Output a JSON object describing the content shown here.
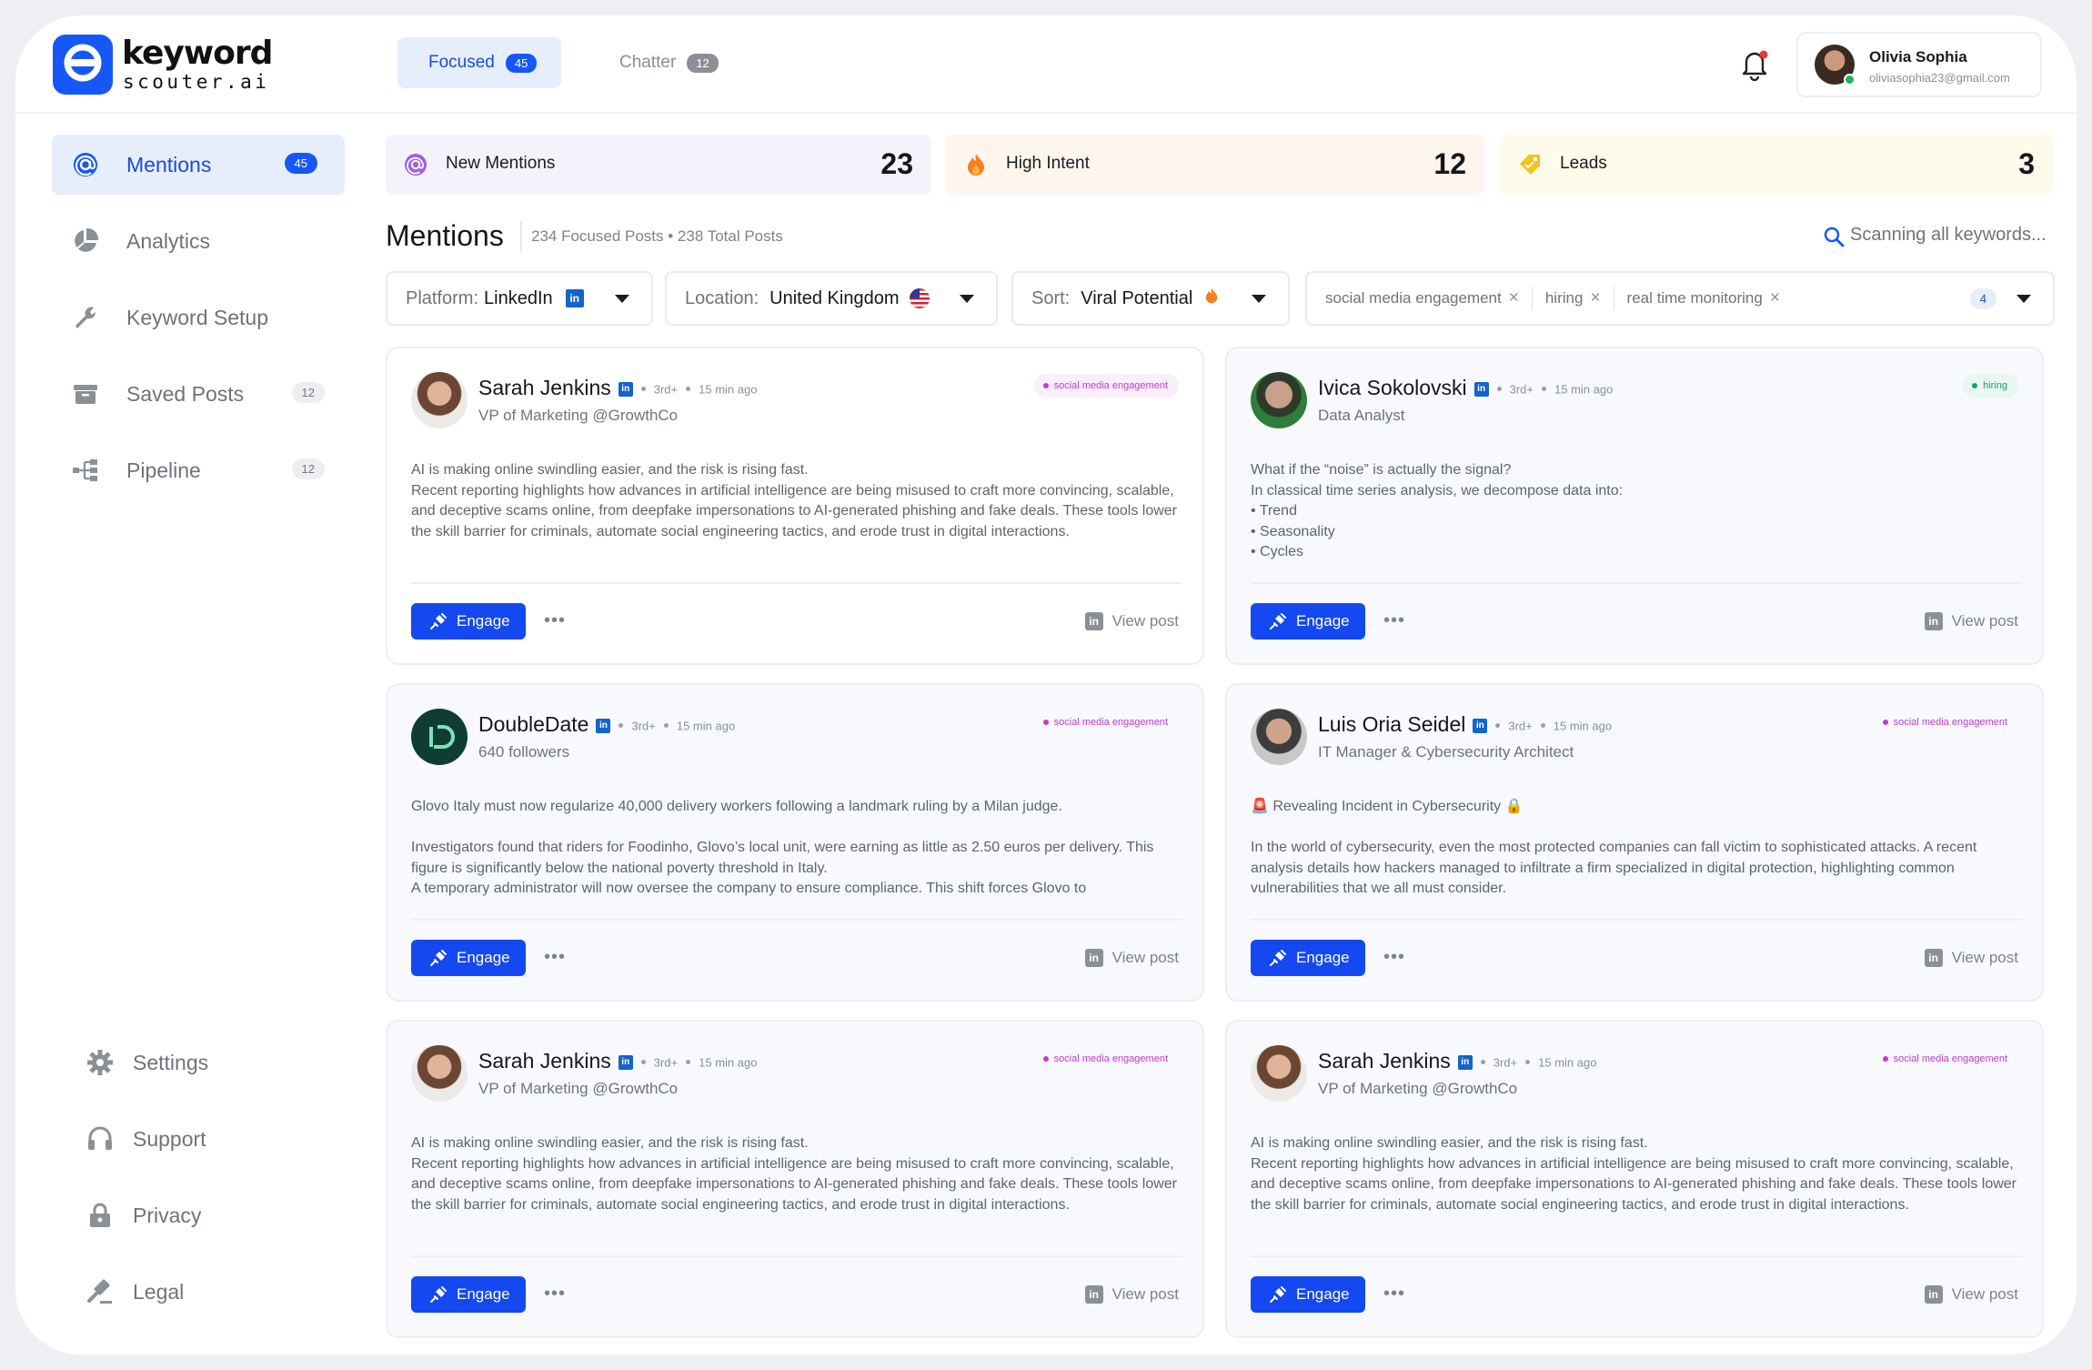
{
  "app": {
    "logo_line1": "keyword",
    "logo_line2": "scouter.ai"
  },
  "tabs": [
    {
      "label": "Focused",
      "count": "45"
    },
    {
      "label": "Chatter",
      "count": "12"
    }
  ],
  "user": {
    "name": "Olivia Sophia",
    "email": "oliviasophia23@gmail.com"
  },
  "sidebar": {
    "items": [
      {
        "label": "Mentions",
        "badge": "45",
        "icon": "at-icon"
      },
      {
        "label": "Analytics",
        "badge": "",
        "icon": "pie-chart-icon"
      },
      {
        "label": "Keyword Setup",
        "badge": "",
        "icon": "wrench-icon"
      },
      {
        "label": "Saved Posts",
        "badge": "12",
        "icon": "archive-icon"
      },
      {
        "label": "Pipeline",
        "badge": "12",
        "icon": "pipeline-icon"
      }
    ],
    "bottom": [
      {
        "label": "Settings",
        "icon": "gear-icon"
      },
      {
        "label": "Support",
        "icon": "headphones-icon"
      },
      {
        "label": "Privacy",
        "icon": "lock-icon"
      },
      {
        "label": "Legal",
        "icon": "gavel-icon"
      }
    ]
  },
  "stats": [
    {
      "label": "New Mentions",
      "value": "23",
      "color": "#f4f3fc"
    },
    {
      "label": "High Intent",
      "value": "12",
      "color": "#fef5ec"
    },
    {
      "label": "Leads",
      "value": "3",
      "color": "#fefbea"
    }
  ],
  "section": {
    "title": "Mentions",
    "subtitle": "234 Focused Posts • 238 Total Posts",
    "scanning": "Scanning all keywords..."
  },
  "filters": {
    "platform_label": "Platform:",
    "platform_value": "LinkedIn",
    "location_label": "Location:",
    "location_value": "United Kingdom",
    "sort_label": "Sort:",
    "sort_value": "Viral Potential",
    "keywords": [
      "social media engagement",
      "hiring",
      "real time monitoring"
    ],
    "keyword_count": "4"
  },
  "common": {
    "degree": "3rd+",
    "time": "15 min ago",
    "engage": "Engage",
    "more": "•••",
    "view_post": "View post"
  },
  "posts": [
    {
      "name": "Sarah Jenkins",
      "subtitle": "VP of Marketing @GrowthCo",
      "tag": "social media engagement",
      "body": "AI is making online swindling easier, and the risk is rising fast.\nRecent reporting highlights how advances in artificial intelligence are being misused to craft more convincing, scalable, and deceptive scams online, from deepfake impersonations to AI-generated phishing and fake deals. These tools lower the skill barrier for criminals, automate social engineering tactics, and erode trust in digital interactions."
    },
    {
      "name": "Ivica Sokolovski",
      "subtitle": "Data Analyst",
      "tag": "hiring",
      "body": "What if the “noise” is actually the signal?\nIn classical time series analysis, we decompose data into:\n• Trend\n• Seasonality\n• Cycles"
    },
    {
      "name": "DoubleDate",
      "subtitle": "640 followers",
      "tag": "social media engagement",
      "body": "Glovo Italy must now regularize 40,000 delivery workers following a landmark ruling by a Milan judge.\n\nInvestigators found that riders for Foodinho, Glovo’s local unit, were earning as little as 2.50 euros per delivery. This figure is significantly below the national poverty threshold in Italy.\nA temporary administrator will now oversee the company to ensure compliance. This shift forces Glovo to"
    },
    {
      "name": "Luis Oria Seidel",
      "subtitle": "IT Manager & Cybersecurity Architect",
      "tag": "social media engagement",
      "body": "🚨 Revealing Incident in Cybersecurity 🔒\n\nIn the world of cybersecurity, even the most protected companies can fall victim to sophisticated attacks. A recent analysis details how hackers managed to infiltrate a firm specialized in digital protection, highlighting common vulnerabilities that we all must consider."
    },
    {
      "name": "Sarah Jenkins",
      "subtitle": "VP of Marketing @GrowthCo",
      "tag": "social media engagement",
      "body": "AI is making online swindling easier, and the risk is rising fast.\nRecent reporting highlights how advances in artificial intelligence are being misused to craft more convincing, scalable, and deceptive scams online, from deepfake impersonations to AI-generated phishing and fake deals. These tools lower the skill barrier for criminals, automate social engineering tactics, and erode trust in digital interactions."
    },
    {
      "name": "Sarah Jenkins",
      "subtitle": "VP of Marketing @GrowthCo",
      "tag": "social media engagement",
      "body": "AI is making online swindling easier, and the risk is rising fast.\nRecent reporting highlights how advances in artificial intelligence are being misused to craft more convincing, scalable, and deceptive scams online, from deepfake impersonations to AI-generated phishing and fake deals. These tools lower the skill barrier for criminals, automate social engineering tactics, and erode trust in digital interactions."
    }
  ],
  "colors": {
    "accent": "#1757f5",
    "engage": "#1448f0",
    "tag_pink": "#c23ad1",
    "tag_green": "#18a36a"
  }
}
